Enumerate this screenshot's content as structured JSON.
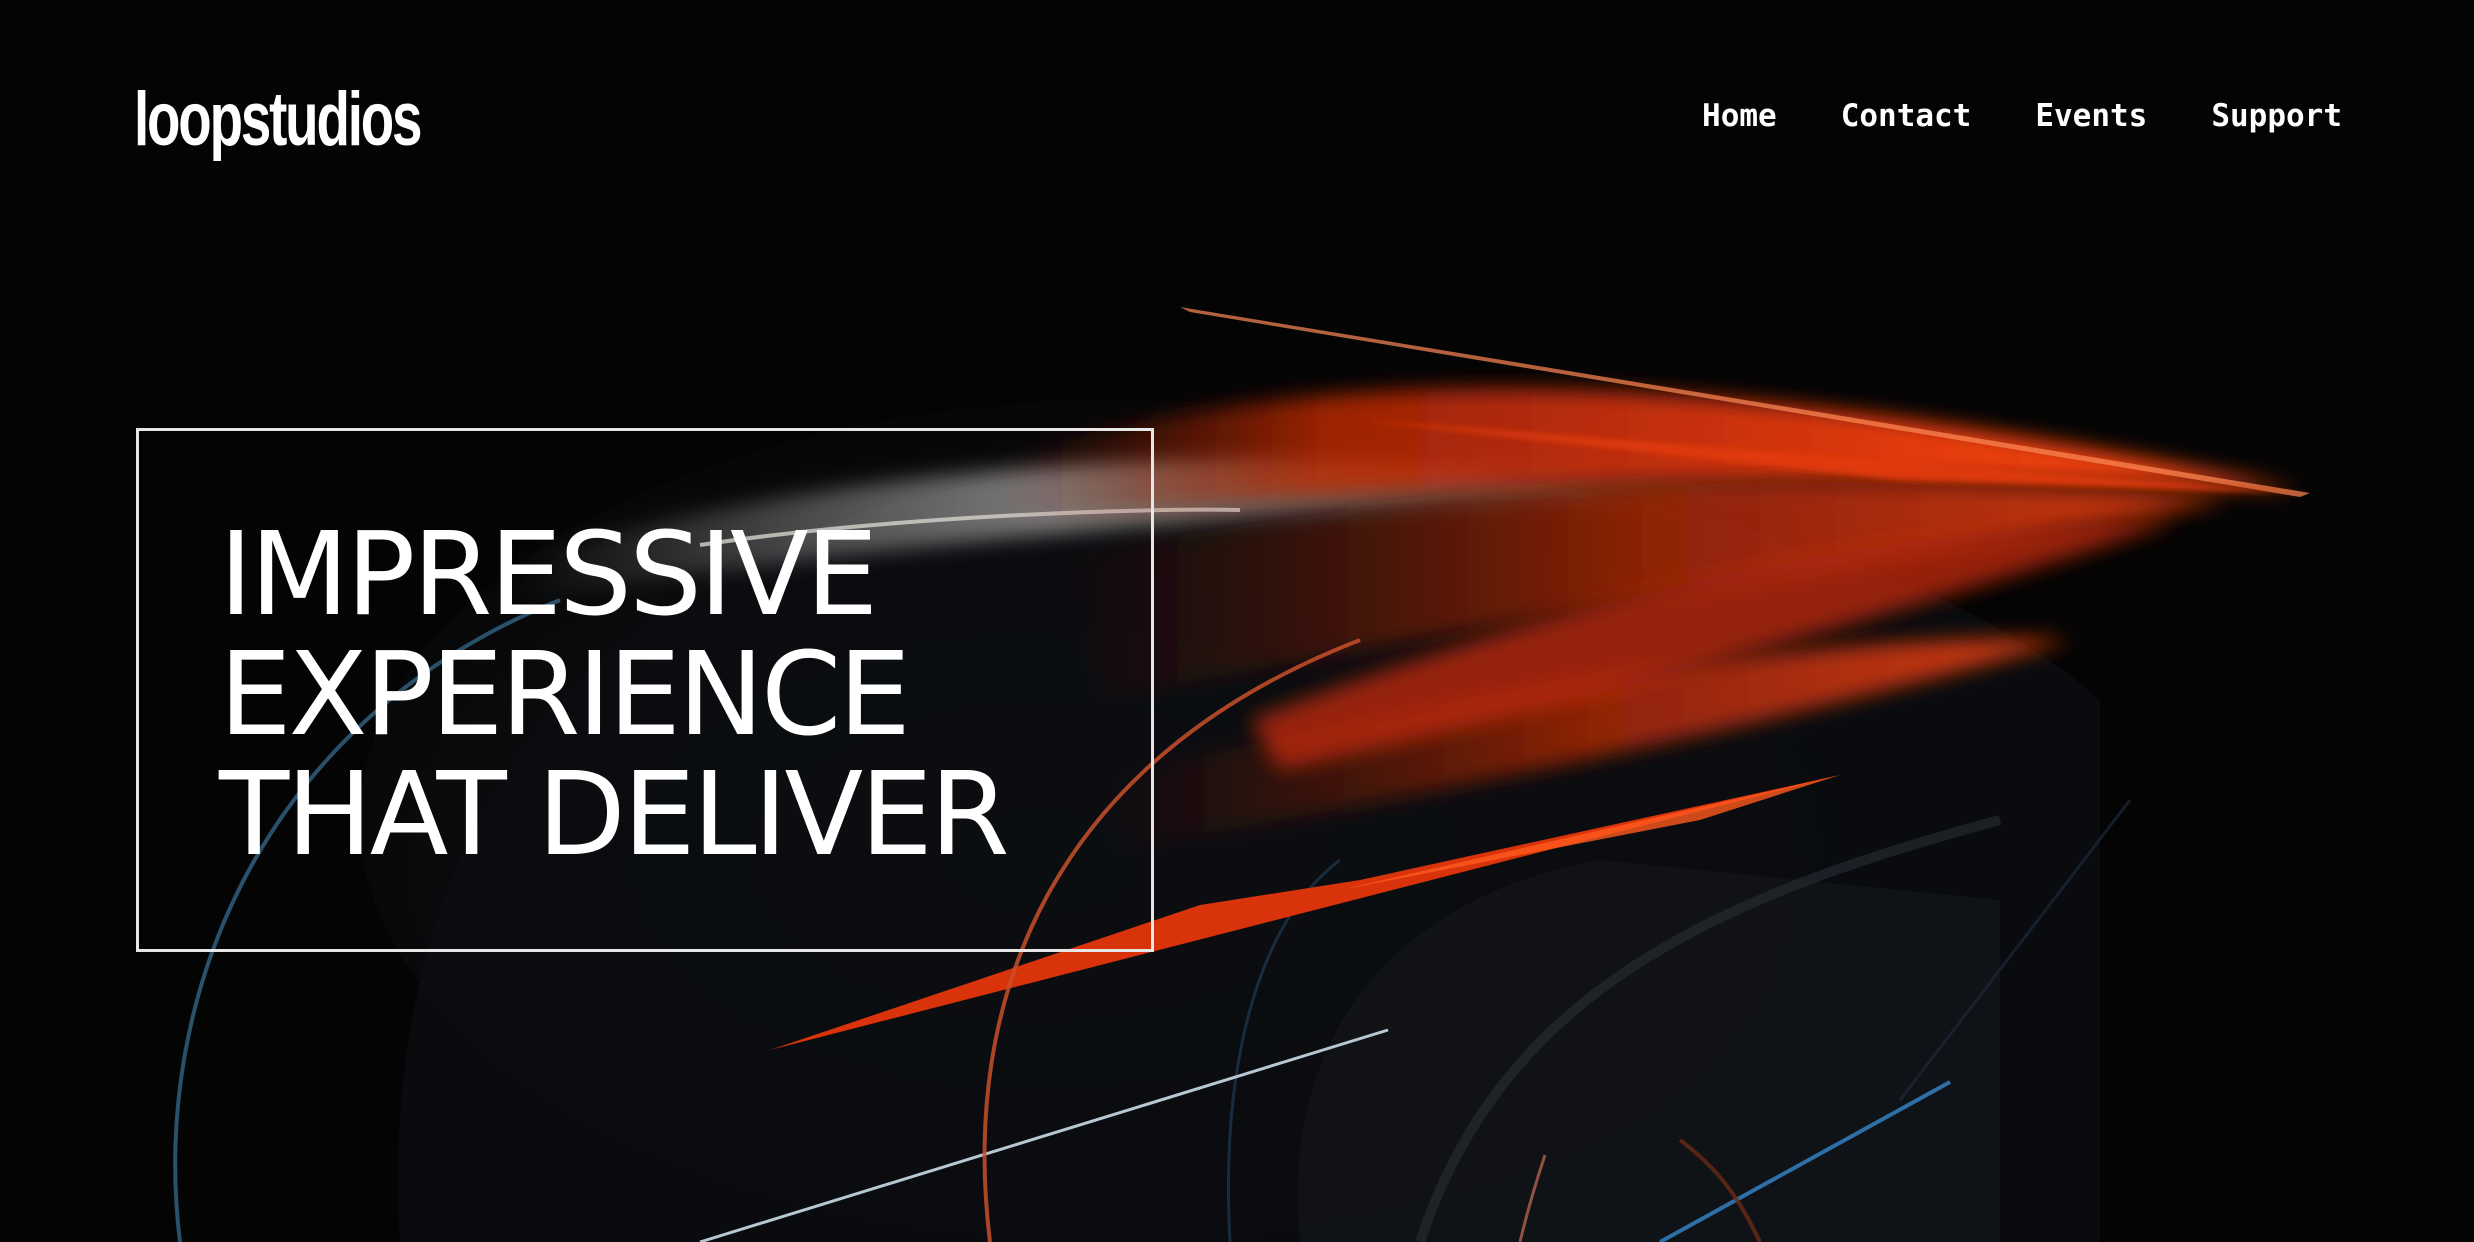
{
  "brand": {
    "logo_text": "loopstudios"
  },
  "nav": {
    "items": [
      {
        "label": "Home"
      },
      {
        "label": "Contact"
      },
      {
        "label": "Events"
      },
      {
        "label": "Support"
      }
    ]
  },
  "hero": {
    "headline_lines": [
      "IMPRESSIVE",
      "EXPERIENCE",
      "THAT DELIVER"
    ],
    "image_icon": "abstract-vr-light-art"
  },
  "colors": {
    "background": "#050505",
    "accent": "#e23a0c",
    "text": "#ffffff",
    "line_blue": "#2f5a78"
  }
}
